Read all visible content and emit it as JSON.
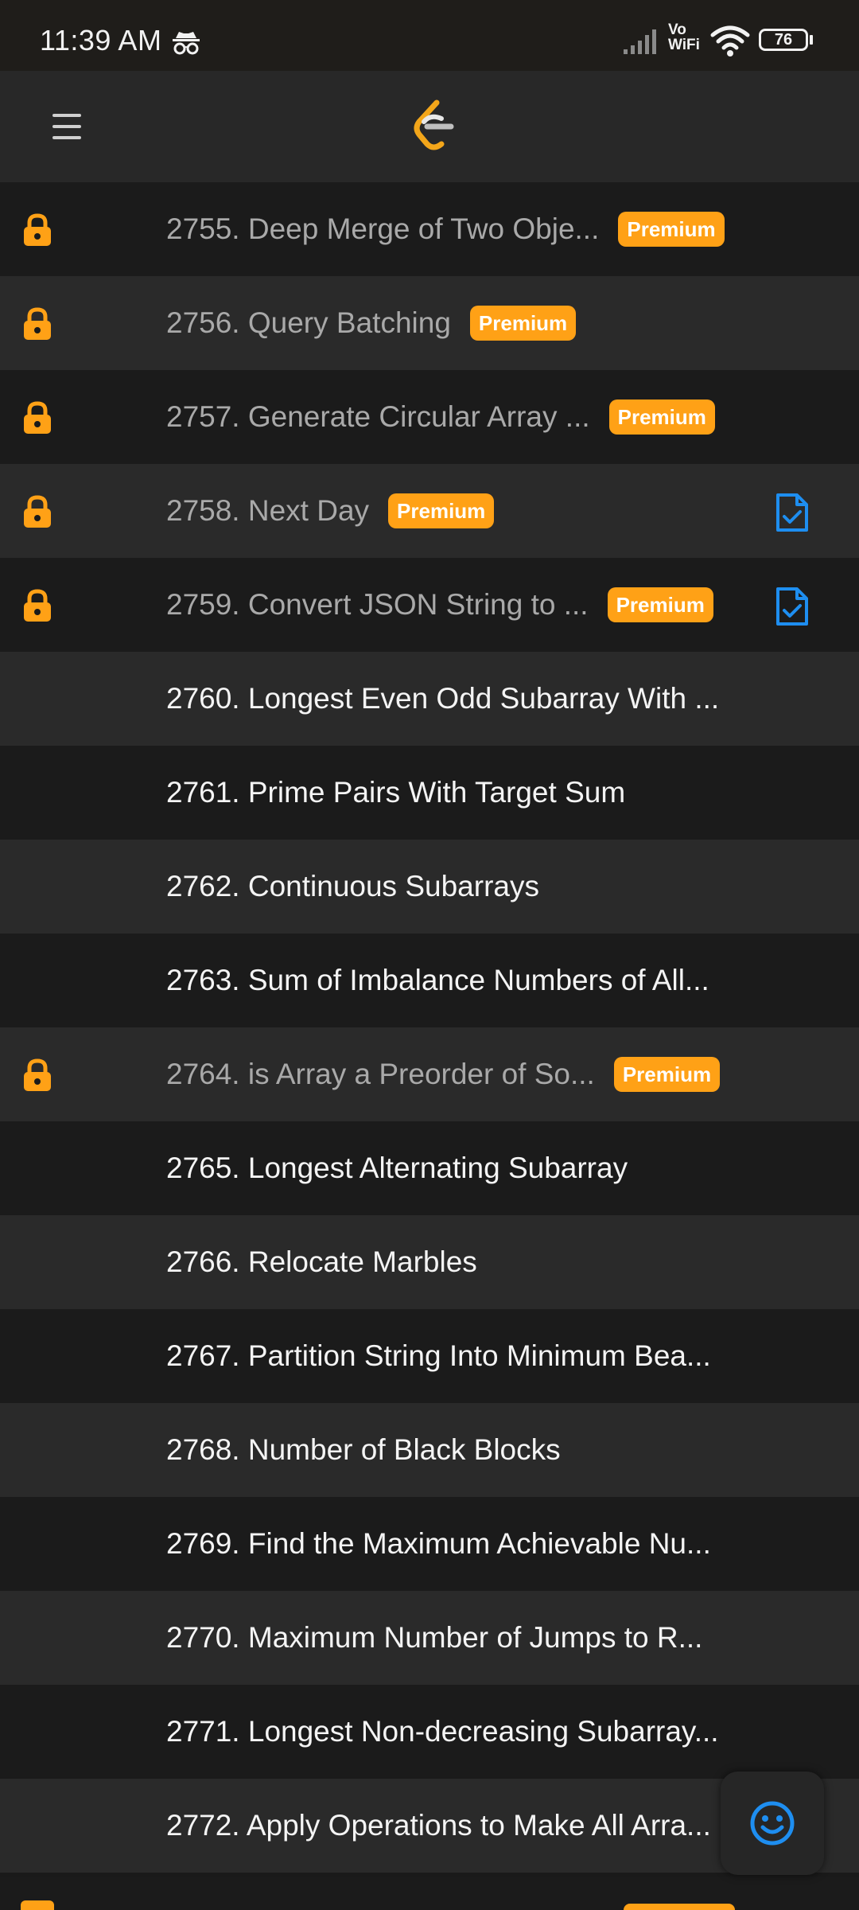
{
  "status_bar": {
    "time": "11:39 AM",
    "network_label_top": "Vo",
    "network_label_bottom": "WiFi",
    "battery_level": "76"
  },
  "header": {
    "menu_icon": "hamburger-menu-icon",
    "logo": "leetcode-logo"
  },
  "colors": {
    "accent": "#ffa116",
    "solution_blue": "#1e8ef0",
    "row_dark": "#1b1b1b",
    "row_light": "#2a2a2a"
  },
  "problems": [
    {
      "title": "2755. Deep Merge of Two Obje...",
      "locked": true,
      "premium": true,
      "solution": false
    },
    {
      "title": "2756. Query Batching",
      "locked": true,
      "premium": true,
      "solution": false
    },
    {
      "title": "2757. Generate Circular Array ...",
      "locked": true,
      "premium": true,
      "solution": false
    },
    {
      "title": "2758. Next Day",
      "locked": true,
      "premium": true,
      "solution": true
    },
    {
      "title": "2759. Convert JSON String to ...",
      "locked": true,
      "premium": true,
      "solution": true
    },
    {
      "title": "2760. Longest Even Odd Subarray With ...",
      "locked": false,
      "premium": false,
      "solution": false
    },
    {
      "title": "2761. Prime Pairs With Target Sum",
      "locked": false,
      "premium": false,
      "solution": false
    },
    {
      "title": "2762. Continuous Subarrays",
      "locked": false,
      "premium": false,
      "solution": false
    },
    {
      "title": "2763. Sum of Imbalance Numbers of All...",
      "locked": false,
      "premium": false,
      "solution": false
    },
    {
      "title": "2764. is Array a Preorder of So...",
      "locked": true,
      "premium": true,
      "solution": false
    },
    {
      "title": "2765. Longest Alternating Subarray",
      "locked": false,
      "premium": false,
      "solution": false
    },
    {
      "title": "2766. Relocate Marbles",
      "locked": false,
      "premium": false,
      "solution": false
    },
    {
      "title": "2767. Partition String Into Minimum Bea...",
      "locked": false,
      "premium": false,
      "solution": false
    },
    {
      "title": "2768. Number of Black Blocks",
      "locked": false,
      "premium": false,
      "solution": false
    },
    {
      "title": "2769. Find the Maximum Achievable Nu...",
      "locked": false,
      "premium": false,
      "solution": false
    },
    {
      "title": "2770. Maximum Number of Jumps to R...",
      "locked": false,
      "premium": false,
      "solution": false
    },
    {
      "title": "2771. Longest Non-decreasing Subarray...",
      "locked": false,
      "premium": false,
      "solution": false
    },
    {
      "title": "2772. Apply Operations to Make All Arra...",
      "locked": false,
      "premium": false,
      "solution": false
    }
  ],
  "premium_label": "Premium",
  "fab": {
    "icon": "smiley-feedback-icon"
  }
}
